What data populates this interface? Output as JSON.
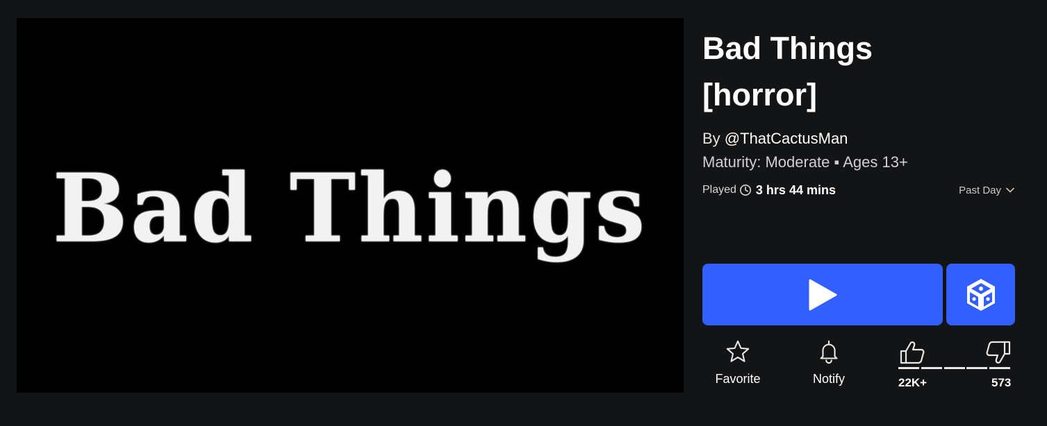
{
  "thumbnail": {
    "text": "Bad Things"
  },
  "game": {
    "title": "Bad Things [horror]",
    "creator_prefix": "By ",
    "creator_handle": "@ThatCactusMan",
    "maturity": "Maturity: Moderate ▪ Ages 13+"
  },
  "stats": {
    "played_label": "Played",
    "played_value": "3 hrs 44 mins",
    "period": "Past Day"
  },
  "actions": {
    "favorite_label": "Favorite",
    "notify_label": "Notify"
  },
  "votes": {
    "up": "22K+",
    "down": "573"
  },
  "icons": {
    "clock": "clock-icon",
    "chevron": "chevron-down-icon",
    "play": "play-icon",
    "studio": "studio-icon",
    "favorite": "star-icon",
    "notify": "bell-icon",
    "thumbs_up": "thumbs-up-icon",
    "thumbs_down": "thumbs-down-icon"
  },
  "colors": {
    "background": "#131416",
    "accent": "#335fff",
    "thumbnail_bg": "#000000"
  }
}
